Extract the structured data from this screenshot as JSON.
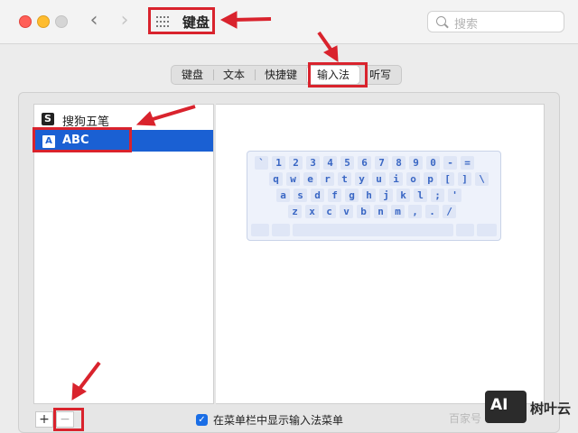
{
  "window": {
    "title": "键盘",
    "search_placeholder": "搜索",
    "nav_back": "‹",
    "nav_forward": "›"
  },
  "tabs": [
    {
      "label": "键盘",
      "active": false
    },
    {
      "label": "文本",
      "active": false
    },
    {
      "label": "快捷键",
      "active": false
    },
    {
      "label": "输入法",
      "active": true
    },
    {
      "label": "听写",
      "active": false
    }
  ],
  "input_sources": [
    {
      "icon": "S",
      "label": "搜狗五笔",
      "selected": false
    },
    {
      "icon": "A",
      "label": "ABC",
      "selected": true
    }
  ],
  "keyboard_rows": [
    [
      "`",
      "1",
      "2",
      "3",
      "4",
      "5",
      "6",
      "7",
      "8",
      "9",
      "0",
      "-",
      "="
    ],
    [
      "q",
      "w",
      "e",
      "r",
      "t",
      "y",
      "u",
      "i",
      "o",
      "p",
      "[",
      "]",
      "\\"
    ],
    [
      "a",
      "s",
      "d",
      "f",
      "g",
      "h",
      "j",
      "k",
      "l",
      ";",
      "'"
    ],
    [
      "z",
      "x",
      "c",
      "v",
      "b",
      "n",
      "m",
      ",",
      ".",
      "/"
    ]
  ],
  "buttons": {
    "add": "+",
    "remove": "−"
  },
  "menu_checkbox": {
    "label": "在菜单栏中显示输入法菜单",
    "checked": true
  },
  "watermark": {
    "text": "百家号",
    "logo": "AI",
    "brand": "树叶云"
  },
  "colors": {
    "selection": "#1a60d3",
    "annotation": "#d9232d",
    "key_text": "#3a67c4"
  }
}
